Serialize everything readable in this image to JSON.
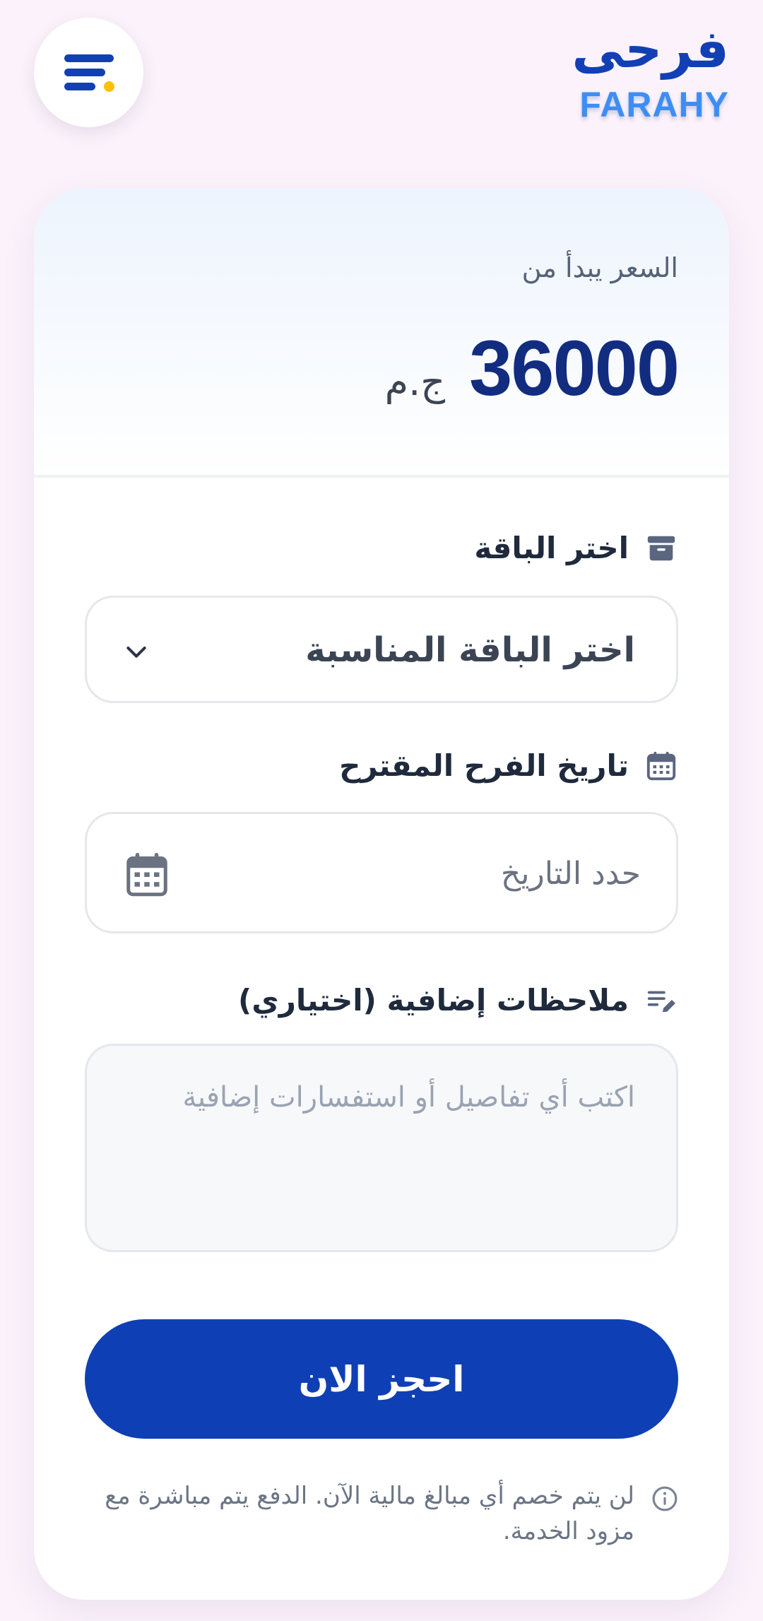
{
  "header": {
    "logo_arabic": "فرحى",
    "logo_english": "FARAHY",
    "menu_icon": "menu-icon"
  },
  "price": {
    "caption": "السعر يبدأ من",
    "value": "36000",
    "currency": "ج.م"
  },
  "form": {
    "package": {
      "label": "اختر الباقة",
      "icon": "archive-box-icon",
      "selected": "اختر الباقة المناسبة"
    },
    "date": {
      "label": "تاريخ الفرح المقترح",
      "icon": "calendar-icon",
      "placeholder": "حدد التاريخ"
    },
    "notes": {
      "label": "ملاحظات إضافية (اختياري)",
      "icon": "edit-notes-icon",
      "placeholder": "اكتب أي تفاصيل أو استفسارات إضافية"
    },
    "submit_label": "احجز الان"
  },
  "notice": {
    "icon": "info-icon",
    "text": "لن يتم خصم أي مبالغ مالية الآن. الدفع يتم مباشرة مع مزود الخدمة."
  },
  "colors": {
    "brand_primary": "#1240b4",
    "brand_light": "#3d8ef4",
    "accent_dot": "#ffc107",
    "button": "#0f3fb4",
    "page_background": "#fcf2fb"
  }
}
